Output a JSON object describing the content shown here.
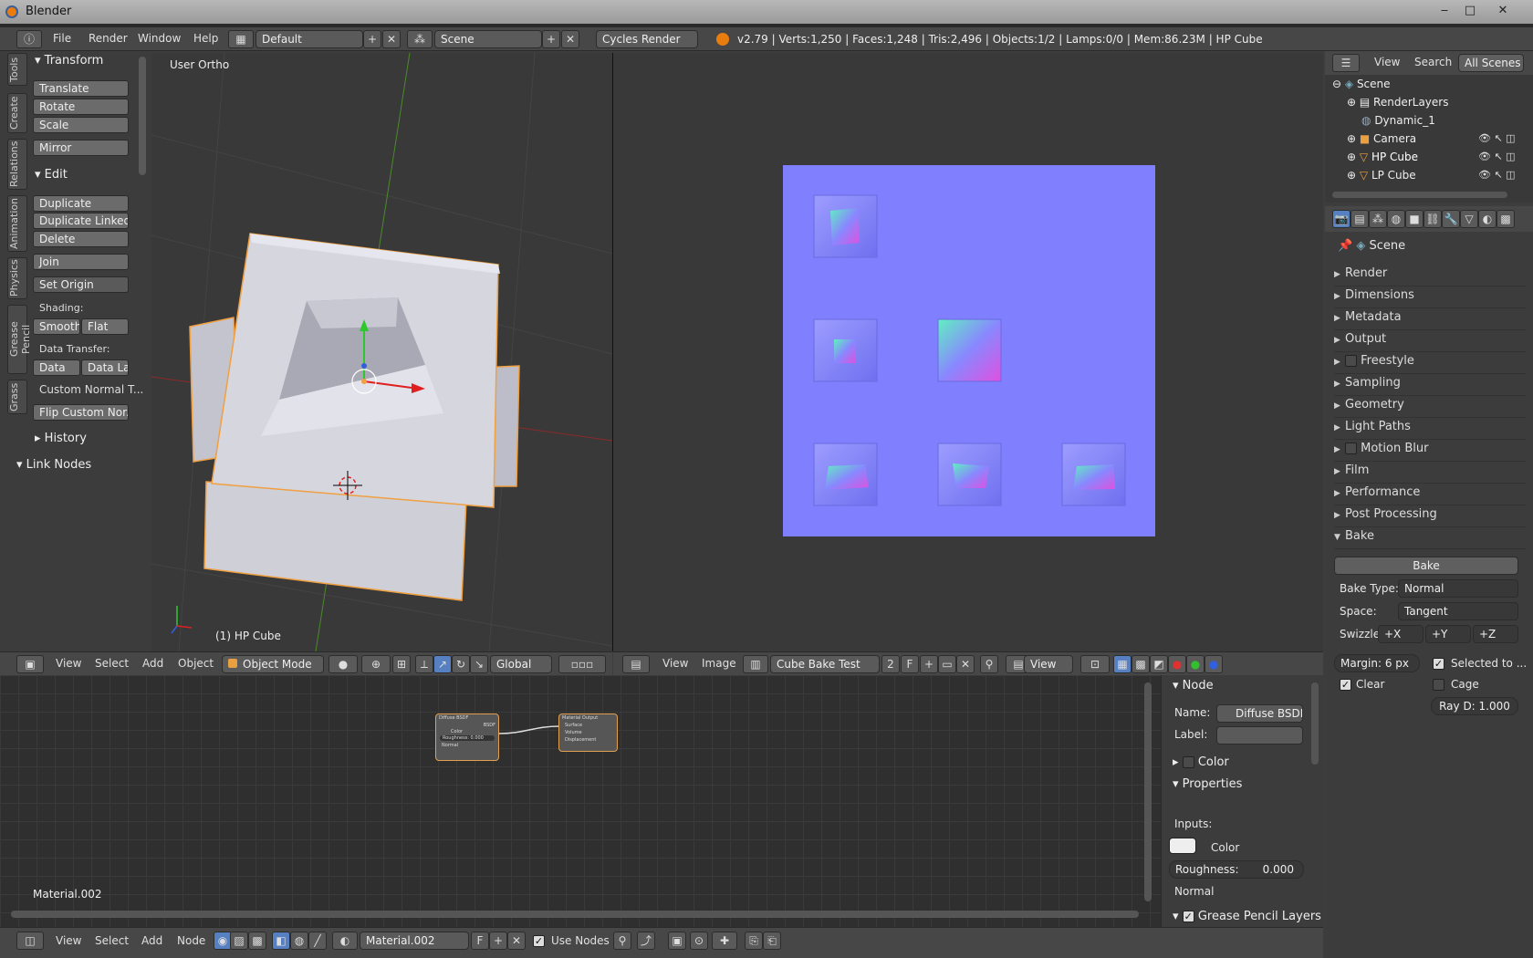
{
  "window": {
    "title": "Blender"
  },
  "info_header": {
    "menus": [
      "File",
      "Render",
      "Window",
      "Help"
    ],
    "screen_layout": "Default",
    "scene": "Scene",
    "render_engine": "Cycles Render",
    "stats": "v2.79 | Verts:1,250 | Faces:1,248 | Tris:2,496 | Objects:1/2 | Lamps:0/0 | Mem:86.23M | HP Cube"
  },
  "tool_shelf": {
    "tabs": [
      "Tools",
      "Create",
      "Relations",
      "Animation",
      "Physics",
      "Grease Pencil",
      "Grass"
    ],
    "transform_title": "Transform",
    "transform_buttons": [
      "Translate",
      "Rotate",
      "Scale"
    ],
    "mirror": "Mirror",
    "edit_title": "Edit",
    "edit_buttons": [
      "Duplicate",
      "Duplicate Linked",
      "Delete"
    ],
    "join": "Join",
    "set_origin": "Set Origin",
    "shading_label": "Shading:",
    "smooth": "Smooth",
    "flat": "Flat",
    "data_transfer_label": "Data Transfer:",
    "data": "Data",
    "data_la": "Data La",
    "custom_normal": "Custom Normal T...",
    "flip_custom": "Flip Custom Nor...",
    "history": "History",
    "link_nodes": "Link Nodes"
  },
  "viewport": {
    "view_label": "User Ortho",
    "object_label": "(1) HP Cube",
    "menus": [
      "View",
      "Select",
      "Add",
      "Object"
    ],
    "mode": "Object Mode",
    "orientation": "Global"
  },
  "image_editor": {
    "menus": [
      "View",
      "Image"
    ],
    "image_name": "Cube Bake Test",
    "users": "2",
    "fake": "F",
    "view_mode": "View"
  },
  "outliner": {
    "menus": [
      "View",
      "Search"
    ],
    "filter": "All Scenes",
    "items": [
      "Scene",
      "RenderLayers",
      "Dynamic_1",
      "Camera",
      "HP Cube",
      "LP Cube"
    ]
  },
  "properties": {
    "context": "Scene",
    "panels": [
      "Render",
      "Dimensions",
      "Metadata",
      "Output",
      "Freestyle",
      "Sampling",
      "Geometry",
      "Light Paths",
      "Motion Blur",
      "Film",
      "Performance",
      "Post Processing",
      "Bake"
    ],
    "bake_button": "Bake",
    "bake_type_label": "Bake Type:",
    "bake_type": "Normal",
    "space_label": "Space:",
    "space": "Tangent",
    "swizzle_label": "Swizzle:",
    "swizzle": [
      "+X",
      "+Y",
      "+Z"
    ],
    "margin": "Margin:  6 px",
    "selected_to": "Selected to ...",
    "clear": "Clear",
    "cage": "Cage",
    "ray_d": "Ray D: 1.000"
  },
  "node_editor": {
    "material_label": "Material.002",
    "menus": [
      "View",
      "Select",
      "Add",
      "Node"
    ],
    "material": "Material.002",
    "fake": "F",
    "use_nodes": "Use Nodes",
    "node_diffuse": {
      "title": "Diffuse BSDF",
      "out": "BSDF",
      "color": "Color",
      "roughness": "Roughness: 0.000",
      "normal": "Normal"
    },
    "node_output": {
      "title": "Material Output",
      "surface": "Surface",
      "volume": "Volume",
      "displacement": "Displacement"
    }
  },
  "node_props": {
    "node_title": "Node",
    "name_label": "Name:",
    "name": "Diffuse BSDF",
    "label_label": "Label:",
    "color_panel": "Color",
    "properties_panel": "Properties",
    "inputs": "Inputs:",
    "color": "Color",
    "roughness_label": "Roughness:",
    "roughness": "0.000",
    "normal": "Normal",
    "grease_pencil": "Grease Pencil Layers"
  },
  "colors": {
    "normal_map_bg": "#8080ff",
    "selection_outline": "#f0a040",
    "accent": "#5680c2"
  }
}
